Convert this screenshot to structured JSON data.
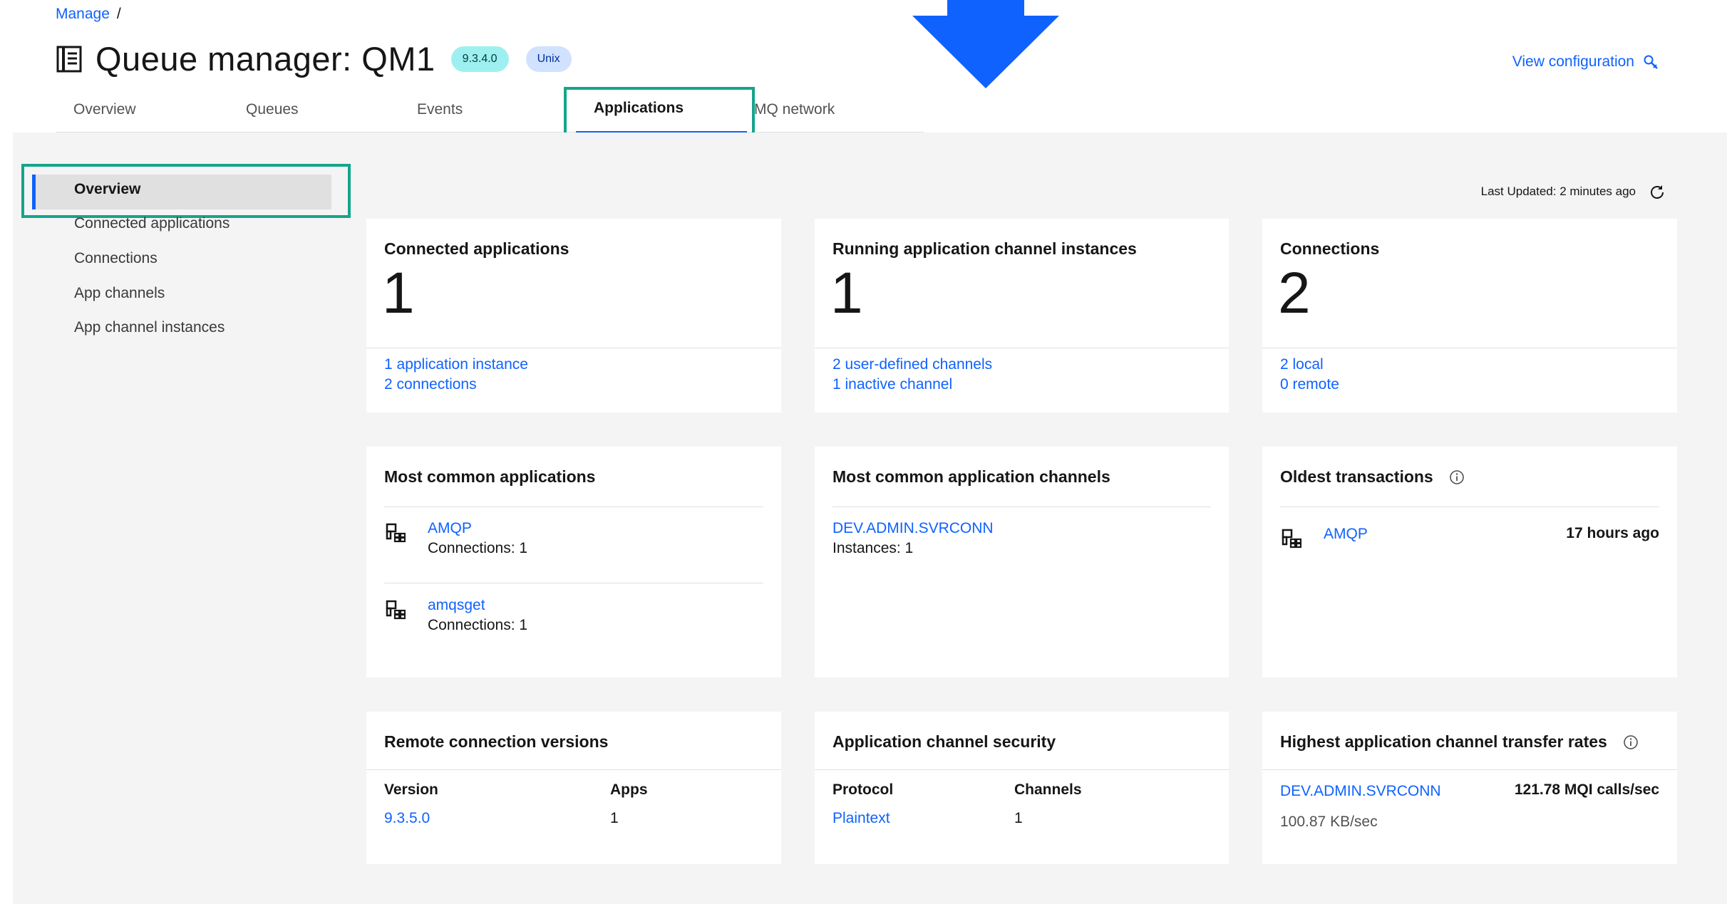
{
  "breadcrumb": {
    "root": "Manage",
    "separator": "/"
  },
  "header": {
    "title": "Queue manager: QM1",
    "version_tag": "9.3.4.0",
    "os_tag": "Unix",
    "view_config": "View configuration"
  },
  "tabs": [
    {
      "label": "Overview"
    },
    {
      "label": "Queues"
    },
    {
      "label": "Events"
    },
    {
      "label": "Applications"
    },
    {
      "label": "MQ network"
    }
  ],
  "sidenav": [
    {
      "label": "Overview"
    },
    {
      "label": "Connected applications"
    },
    {
      "label": "Connections"
    },
    {
      "label": "App channels"
    },
    {
      "label": "App channel instances"
    }
  ],
  "last_updated": "Last Updated: 2 minutes ago",
  "tiles": {
    "connected_apps": {
      "title": "Connected applications",
      "value": "1",
      "link1": "1 application instance",
      "link2": "2 connections"
    },
    "running_channels": {
      "title": "Running application channel instances",
      "value": "1",
      "link1": "2 user-defined channels",
      "link2": "1 inactive channel"
    },
    "connections": {
      "title": "Connections",
      "value": "2",
      "link1": "2 local",
      "link2": "0 remote"
    },
    "common_apps": {
      "title": "Most common applications",
      "items": [
        {
          "name": "AMQP",
          "detail": "Connections: 1"
        },
        {
          "name": "amqsget",
          "detail": "Connections: 1"
        }
      ]
    },
    "common_channels": {
      "title": "Most common application channels",
      "items": [
        {
          "name": "DEV.ADMIN.SVRCONN",
          "detail": "Instances: 1"
        }
      ]
    },
    "oldest_tx": {
      "title": "Oldest transactions",
      "items": [
        {
          "name": "AMQP",
          "age": "17 hours ago"
        }
      ]
    },
    "remote_versions": {
      "title": "Remote connection versions",
      "col1": "Version",
      "col2": "Apps",
      "rows": [
        {
          "version": "9.3.5.0",
          "apps": "1"
        }
      ]
    },
    "channel_security": {
      "title": "Application channel security",
      "col1": "Protocol",
      "col2": "Channels",
      "rows": [
        {
          "protocol": "Plaintext",
          "channels": "1"
        }
      ]
    },
    "transfer_rates": {
      "title": "Highest application channel transfer rates",
      "items": [
        {
          "name": "DEV.ADMIN.SVRCONN",
          "rate": "121.78 MQI calls/sec",
          "bytes": "100.87 KB/sec"
        }
      ]
    }
  },
  "colors": {
    "accent": "#0f62fe",
    "highlight": "#14a58a",
    "arrow": "#0f62fe"
  }
}
